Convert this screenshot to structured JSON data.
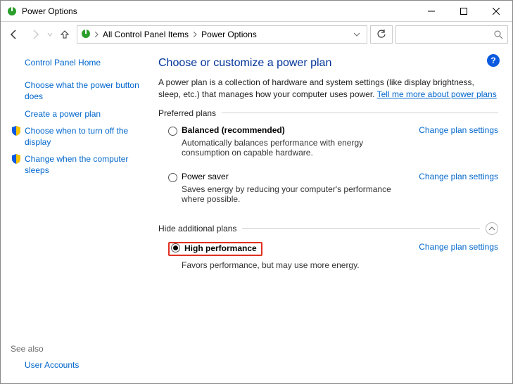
{
  "window": {
    "title": "Power Options"
  },
  "breadcrumb": {
    "item1": "All Control Panel Items",
    "item2": "Power Options"
  },
  "sidebar": {
    "home": "Control Panel Home",
    "link_powerbutton": "Choose what the power button does",
    "link_createplan": "Create a power plan",
    "link_displayoff": "Choose when to turn off the display",
    "link_sleep": "Change when the computer sleeps",
    "seealso_header": "See also",
    "seealso_useraccounts": "User Accounts"
  },
  "main": {
    "heading": "Choose or customize a power plan",
    "intro_prefix": "A power plan is a collection of hardware and system settings (like display brightness, sleep, etc.) that manages how your computer uses power. ",
    "intro_link": "Tell me more about power plans",
    "preferred_label": "Preferred plans",
    "additional_label": "Hide additional plans",
    "change_settings": "Change plan settings",
    "plans": {
      "balanced": {
        "name": "Balanced (recommended)",
        "desc": "Automatically balances performance with energy consumption on capable hardware."
      },
      "powersaver": {
        "name": "Power saver",
        "desc": "Saves energy by reducing your computer's performance where possible."
      },
      "highperf": {
        "name": "High performance",
        "desc": "Favors performance, but may use more energy."
      }
    }
  }
}
